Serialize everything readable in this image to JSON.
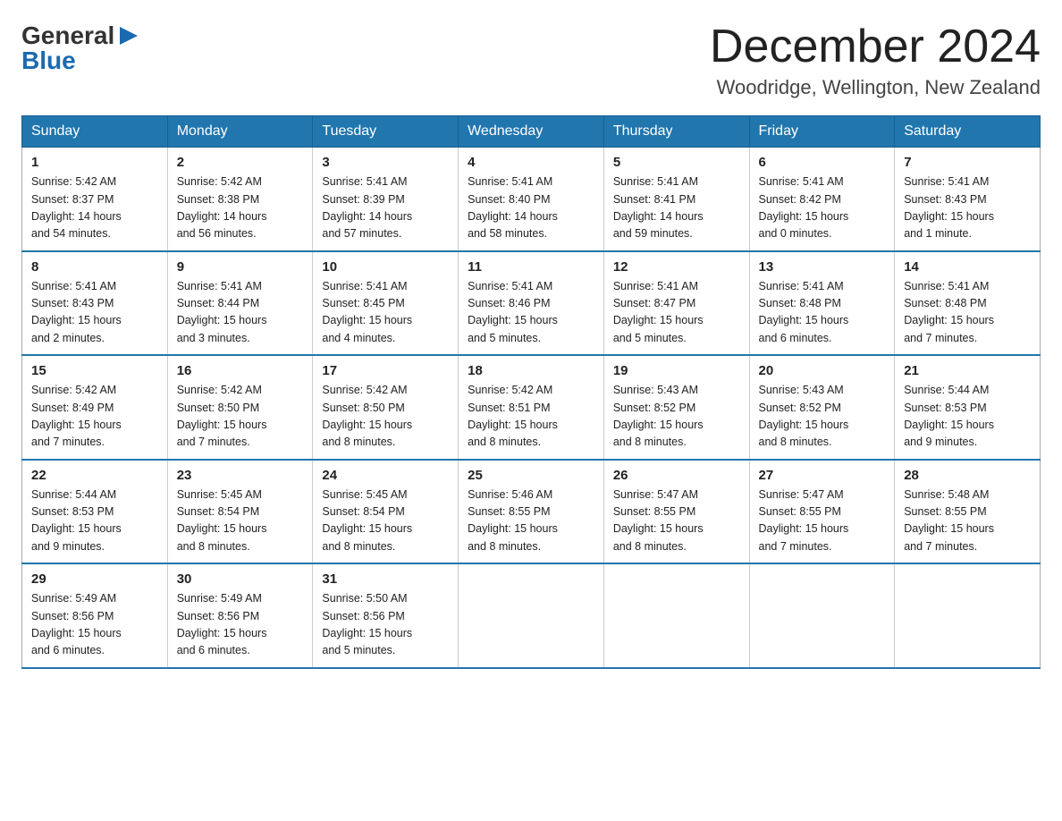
{
  "header": {
    "logo": {
      "general": "General",
      "blue": "Blue",
      "arrow_unicode": "▶"
    },
    "title": "December 2024",
    "subtitle": "Woodridge, Wellington, New Zealand"
  },
  "days_of_week": [
    "Sunday",
    "Monday",
    "Tuesday",
    "Wednesday",
    "Thursday",
    "Friday",
    "Saturday"
  ],
  "weeks": [
    [
      {
        "num": "1",
        "info": "Sunrise: 5:42 AM\nSunset: 8:37 PM\nDaylight: 14 hours\nand 54 minutes."
      },
      {
        "num": "2",
        "info": "Sunrise: 5:42 AM\nSunset: 8:38 PM\nDaylight: 14 hours\nand 56 minutes."
      },
      {
        "num": "3",
        "info": "Sunrise: 5:41 AM\nSunset: 8:39 PM\nDaylight: 14 hours\nand 57 minutes."
      },
      {
        "num": "4",
        "info": "Sunrise: 5:41 AM\nSunset: 8:40 PM\nDaylight: 14 hours\nand 58 minutes."
      },
      {
        "num": "5",
        "info": "Sunrise: 5:41 AM\nSunset: 8:41 PM\nDaylight: 14 hours\nand 59 minutes."
      },
      {
        "num": "6",
        "info": "Sunrise: 5:41 AM\nSunset: 8:42 PM\nDaylight: 15 hours\nand 0 minutes."
      },
      {
        "num": "7",
        "info": "Sunrise: 5:41 AM\nSunset: 8:43 PM\nDaylight: 15 hours\nand 1 minute."
      }
    ],
    [
      {
        "num": "8",
        "info": "Sunrise: 5:41 AM\nSunset: 8:43 PM\nDaylight: 15 hours\nand 2 minutes."
      },
      {
        "num": "9",
        "info": "Sunrise: 5:41 AM\nSunset: 8:44 PM\nDaylight: 15 hours\nand 3 minutes."
      },
      {
        "num": "10",
        "info": "Sunrise: 5:41 AM\nSunset: 8:45 PM\nDaylight: 15 hours\nand 4 minutes."
      },
      {
        "num": "11",
        "info": "Sunrise: 5:41 AM\nSunset: 8:46 PM\nDaylight: 15 hours\nand 5 minutes."
      },
      {
        "num": "12",
        "info": "Sunrise: 5:41 AM\nSunset: 8:47 PM\nDaylight: 15 hours\nand 5 minutes."
      },
      {
        "num": "13",
        "info": "Sunrise: 5:41 AM\nSunset: 8:48 PM\nDaylight: 15 hours\nand 6 minutes."
      },
      {
        "num": "14",
        "info": "Sunrise: 5:41 AM\nSunset: 8:48 PM\nDaylight: 15 hours\nand 7 minutes."
      }
    ],
    [
      {
        "num": "15",
        "info": "Sunrise: 5:42 AM\nSunset: 8:49 PM\nDaylight: 15 hours\nand 7 minutes."
      },
      {
        "num": "16",
        "info": "Sunrise: 5:42 AM\nSunset: 8:50 PM\nDaylight: 15 hours\nand 7 minutes."
      },
      {
        "num": "17",
        "info": "Sunrise: 5:42 AM\nSunset: 8:50 PM\nDaylight: 15 hours\nand 8 minutes."
      },
      {
        "num": "18",
        "info": "Sunrise: 5:42 AM\nSunset: 8:51 PM\nDaylight: 15 hours\nand 8 minutes."
      },
      {
        "num": "19",
        "info": "Sunrise: 5:43 AM\nSunset: 8:52 PM\nDaylight: 15 hours\nand 8 minutes."
      },
      {
        "num": "20",
        "info": "Sunrise: 5:43 AM\nSunset: 8:52 PM\nDaylight: 15 hours\nand 8 minutes."
      },
      {
        "num": "21",
        "info": "Sunrise: 5:44 AM\nSunset: 8:53 PM\nDaylight: 15 hours\nand 9 minutes."
      }
    ],
    [
      {
        "num": "22",
        "info": "Sunrise: 5:44 AM\nSunset: 8:53 PM\nDaylight: 15 hours\nand 9 minutes."
      },
      {
        "num": "23",
        "info": "Sunrise: 5:45 AM\nSunset: 8:54 PM\nDaylight: 15 hours\nand 8 minutes."
      },
      {
        "num": "24",
        "info": "Sunrise: 5:45 AM\nSunset: 8:54 PM\nDaylight: 15 hours\nand 8 minutes."
      },
      {
        "num": "25",
        "info": "Sunrise: 5:46 AM\nSunset: 8:55 PM\nDaylight: 15 hours\nand 8 minutes."
      },
      {
        "num": "26",
        "info": "Sunrise: 5:47 AM\nSunset: 8:55 PM\nDaylight: 15 hours\nand 8 minutes."
      },
      {
        "num": "27",
        "info": "Sunrise: 5:47 AM\nSunset: 8:55 PM\nDaylight: 15 hours\nand 7 minutes."
      },
      {
        "num": "28",
        "info": "Sunrise: 5:48 AM\nSunset: 8:55 PM\nDaylight: 15 hours\nand 7 minutes."
      }
    ],
    [
      {
        "num": "29",
        "info": "Sunrise: 5:49 AM\nSunset: 8:56 PM\nDaylight: 15 hours\nand 6 minutes."
      },
      {
        "num": "30",
        "info": "Sunrise: 5:49 AM\nSunset: 8:56 PM\nDaylight: 15 hours\nand 6 minutes."
      },
      {
        "num": "31",
        "info": "Sunrise: 5:50 AM\nSunset: 8:56 PM\nDaylight: 15 hours\nand 5 minutes."
      },
      {
        "num": "",
        "info": ""
      },
      {
        "num": "",
        "info": ""
      },
      {
        "num": "",
        "info": ""
      },
      {
        "num": "",
        "info": ""
      }
    ]
  ],
  "colors": {
    "header_bg": "#2176ae",
    "header_text": "#ffffff",
    "border": "#2176ae",
    "body_bg": "#ffffff",
    "text": "#222222"
  }
}
